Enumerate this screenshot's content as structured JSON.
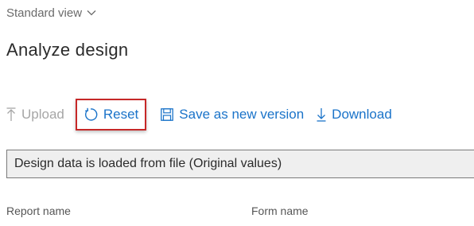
{
  "view_selector": {
    "label": "Standard view"
  },
  "page_title": "Analyze design",
  "toolbar": {
    "upload_label": "Upload",
    "reset_label": "Reset",
    "save_label": "Save as new version",
    "download_label": "Download"
  },
  "info_bar": {
    "message": "Design data is loaded from file (Original values)"
  },
  "columns": {
    "report_name": "Report name",
    "form_name": "Form name"
  },
  "colors": {
    "link": "#1a73c9",
    "disabled": "#a6a6a6",
    "highlight_border": "#c62828"
  }
}
